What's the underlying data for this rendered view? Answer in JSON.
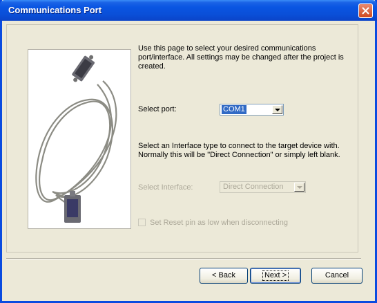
{
  "window": {
    "title": "Communications Port"
  },
  "intro_text": "Use this page to select your desired communications port/interface. All settings may be changed after the project is created.",
  "port": {
    "label": "Select port:",
    "value": "COM1"
  },
  "interface_text": "Select an Interface type to connect to the target device with. Normally this will be \"Direct Connection\" or simply left blank.",
  "interface": {
    "label": "Select Interface:",
    "value": "Direct Connection"
  },
  "reset_pin": {
    "label": "Set Reset pin as low when disconnecting",
    "checked": false
  },
  "buttons": {
    "back": "< Back",
    "next": "Next >",
    "cancel": "Cancel"
  },
  "colors": {
    "titlebar": "#0955e2",
    "selection": "#316ac5",
    "dialog_bg": "#ece9d8"
  },
  "icons": {
    "close": "close-icon",
    "picture": "serial-cable-picture"
  }
}
